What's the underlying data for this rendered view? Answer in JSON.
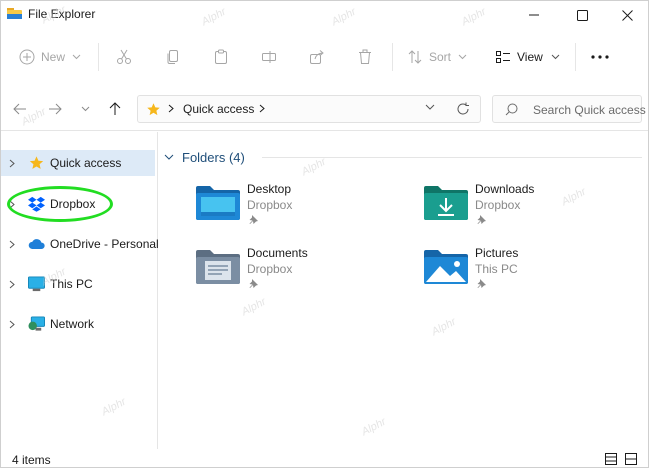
{
  "window": {
    "title": "File Explorer"
  },
  "toolbar": {
    "new_label": "New",
    "sort_label": "Sort",
    "view_label": "View"
  },
  "address": {
    "location": "Quick access",
    "search_placeholder": "Search Quick access"
  },
  "sidebar": {
    "items": [
      {
        "label": "Quick access",
        "icon": "star-icon"
      },
      {
        "label": "Dropbox",
        "icon": "dropbox-icon"
      },
      {
        "label": "OneDrive - Personal",
        "icon": "cloud-icon"
      },
      {
        "label": "This PC",
        "icon": "monitor-icon"
      },
      {
        "label": "Network",
        "icon": "network-icon"
      }
    ]
  },
  "content": {
    "group_label": "Folders (4)",
    "folders": [
      {
        "name": "Desktop",
        "location": "Dropbox",
        "icon": "desktop-folder-icon"
      },
      {
        "name": "Downloads",
        "location": "Dropbox",
        "icon": "downloads-folder-icon"
      },
      {
        "name": "Documents",
        "location": "Dropbox",
        "icon": "documents-folder-icon"
      },
      {
        "name": "Pictures",
        "location": "This PC",
        "icon": "pictures-folder-icon"
      }
    ]
  },
  "status": {
    "item_count": "4 items"
  },
  "watermark": "Alphr",
  "colors": {
    "selected_bg": "#ddeaf7",
    "highlight_ring": "#22dd22",
    "folder_blue": "#1e88d6",
    "folder_teal": "#1a9e8f",
    "star_yellow": "#f6b71c"
  }
}
